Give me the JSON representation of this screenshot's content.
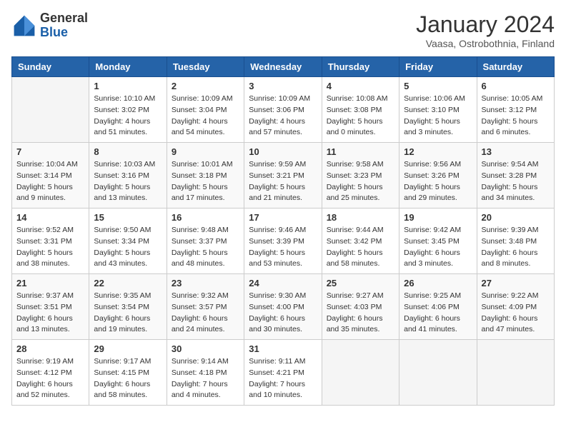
{
  "header": {
    "logo_general": "General",
    "logo_blue": "Blue",
    "month_title": "January 2024",
    "location": "Vaasa, Ostrobothnia, Finland"
  },
  "weekdays": [
    "Sunday",
    "Monday",
    "Tuesday",
    "Wednesday",
    "Thursday",
    "Friday",
    "Saturday"
  ],
  "weeks": [
    [
      {
        "day": "",
        "sunrise": "",
        "sunset": "",
        "daylight": ""
      },
      {
        "day": "1",
        "sunrise": "Sunrise: 10:10 AM",
        "sunset": "Sunset: 3:02 PM",
        "daylight": "Daylight: 4 hours and 51 minutes."
      },
      {
        "day": "2",
        "sunrise": "Sunrise: 10:09 AM",
        "sunset": "Sunset: 3:04 PM",
        "daylight": "Daylight: 4 hours and 54 minutes."
      },
      {
        "day": "3",
        "sunrise": "Sunrise: 10:09 AM",
        "sunset": "Sunset: 3:06 PM",
        "daylight": "Daylight: 4 hours and 57 minutes."
      },
      {
        "day": "4",
        "sunrise": "Sunrise: 10:08 AM",
        "sunset": "Sunset: 3:08 PM",
        "daylight": "Daylight: 5 hours and 0 minutes."
      },
      {
        "day": "5",
        "sunrise": "Sunrise: 10:06 AM",
        "sunset": "Sunset: 3:10 PM",
        "daylight": "Daylight: 5 hours and 3 minutes."
      },
      {
        "day": "6",
        "sunrise": "Sunrise: 10:05 AM",
        "sunset": "Sunset: 3:12 PM",
        "daylight": "Daylight: 5 hours and 6 minutes."
      }
    ],
    [
      {
        "day": "7",
        "sunrise": "Sunrise: 10:04 AM",
        "sunset": "Sunset: 3:14 PM",
        "daylight": "Daylight: 5 hours and 9 minutes."
      },
      {
        "day": "8",
        "sunrise": "Sunrise: 10:03 AM",
        "sunset": "Sunset: 3:16 PM",
        "daylight": "Daylight: 5 hours and 13 minutes."
      },
      {
        "day": "9",
        "sunrise": "Sunrise: 10:01 AM",
        "sunset": "Sunset: 3:18 PM",
        "daylight": "Daylight: 5 hours and 17 minutes."
      },
      {
        "day": "10",
        "sunrise": "Sunrise: 9:59 AM",
        "sunset": "Sunset: 3:21 PM",
        "daylight": "Daylight: 5 hours and 21 minutes."
      },
      {
        "day": "11",
        "sunrise": "Sunrise: 9:58 AM",
        "sunset": "Sunset: 3:23 PM",
        "daylight": "Daylight: 5 hours and 25 minutes."
      },
      {
        "day": "12",
        "sunrise": "Sunrise: 9:56 AM",
        "sunset": "Sunset: 3:26 PM",
        "daylight": "Daylight: 5 hours and 29 minutes."
      },
      {
        "day": "13",
        "sunrise": "Sunrise: 9:54 AM",
        "sunset": "Sunset: 3:28 PM",
        "daylight": "Daylight: 5 hours and 34 minutes."
      }
    ],
    [
      {
        "day": "14",
        "sunrise": "Sunrise: 9:52 AM",
        "sunset": "Sunset: 3:31 PM",
        "daylight": "Daylight: 5 hours and 38 minutes."
      },
      {
        "day": "15",
        "sunrise": "Sunrise: 9:50 AM",
        "sunset": "Sunset: 3:34 PM",
        "daylight": "Daylight: 5 hours and 43 minutes."
      },
      {
        "day": "16",
        "sunrise": "Sunrise: 9:48 AM",
        "sunset": "Sunset: 3:37 PM",
        "daylight": "Daylight: 5 hours and 48 minutes."
      },
      {
        "day": "17",
        "sunrise": "Sunrise: 9:46 AM",
        "sunset": "Sunset: 3:39 PM",
        "daylight": "Daylight: 5 hours and 53 minutes."
      },
      {
        "day": "18",
        "sunrise": "Sunrise: 9:44 AM",
        "sunset": "Sunset: 3:42 PM",
        "daylight": "Daylight: 5 hours and 58 minutes."
      },
      {
        "day": "19",
        "sunrise": "Sunrise: 9:42 AM",
        "sunset": "Sunset: 3:45 PM",
        "daylight": "Daylight: 6 hours and 3 minutes."
      },
      {
        "day": "20",
        "sunrise": "Sunrise: 9:39 AM",
        "sunset": "Sunset: 3:48 PM",
        "daylight": "Daylight: 6 hours and 8 minutes."
      }
    ],
    [
      {
        "day": "21",
        "sunrise": "Sunrise: 9:37 AM",
        "sunset": "Sunset: 3:51 PM",
        "daylight": "Daylight: 6 hours and 13 minutes."
      },
      {
        "day": "22",
        "sunrise": "Sunrise: 9:35 AM",
        "sunset": "Sunset: 3:54 PM",
        "daylight": "Daylight: 6 hours and 19 minutes."
      },
      {
        "day": "23",
        "sunrise": "Sunrise: 9:32 AM",
        "sunset": "Sunset: 3:57 PM",
        "daylight": "Daylight: 6 hours and 24 minutes."
      },
      {
        "day": "24",
        "sunrise": "Sunrise: 9:30 AM",
        "sunset": "Sunset: 4:00 PM",
        "daylight": "Daylight: 6 hours and 30 minutes."
      },
      {
        "day": "25",
        "sunrise": "Sunrise: 9:27 AM",
        "sunset": "Sunset: 4:03 PM",
        "daylight": "Daylight: 6 hours and 35 minutes."
      },
      {
        "day": "26",
        "sunrise": "Sunrise: 9:25 AM",
        "sunset": "Sunset: 4:06 PM",
        "daylight": "Daylight: 6 hours and 41 minutes."
      },
      {
        "day": "27",
        "sunrise": "Sunrise: 9:22 AM",
        "sunset": "Sunset: 4:09 PM",
        "daylight": "Daylight: 6 hours and 47 minutes."
      }
    ],
    [
      {
        "day": "28",
        "sunrise": "Sunrise: 9:19 AM",
        "sunset": "Sunset: 4:12 PM",
        "daylight": "Daylight: 6 hours and 52 minutes."
      },
      {
        "day": "29",
        "sunrise": "Sunrise: 9:17 AM",
        "sunset": "Sunset: 4:15 PM",
        "daylight": "Daylight: 6 hours and 58 minutes."
      },
      {
        "day": "30",
        "sunrise": "Sunrise: 9:14 AM",
        "sunset": "Sunset: 4:18 PM",
        "daylight": "Daylight: 7 hours and 4 minutes."
      },
      {
        "day": "31",
        "sunrise": "Sunrise: 9:11 AM",
        "sunset": "Sunset: 4:21 PM",
        "daylight": "Daylight: 7 hours and 10 minutes."
      },
      {
        "day": "",
        "sunrise": "",
        "sunset": "",
        "daylight": ""
      },
      {
        "day": "",
        "sunrise": "",
        "sunset": "",
        "daylight": ""
      },
      {
        "day": "",
        "sunrise": "",
        "sunset": "",
        "daylight": ""
      }
    ]
  ]
}
